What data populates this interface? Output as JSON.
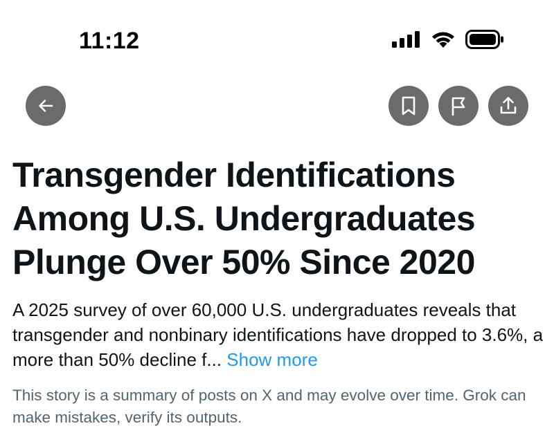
{
  "status_bar": {
    "time": "11:12",
    "icons": [
      "cellular-signal-icon",
      "wifi-icon",
      "battery-icon"
    ]
  },
  "header": {
    "buttons": [
      {
        "name": "back-button",
        "icon": "arrow-left-icon"
      },
      {
        "name": "bookmark-button",
        "icon": "bookmark-icon"
      },
      {
        "name": "report-button",
        "icon": "flag-icon"
      },
      {
        "name": "share-button",
        "icon": "share-upload-icon"
      }
    ],
    "button_color": "#6b6b6b"
  },
  "story": {
    "title": "Transgender Identifications Among U.S. Undergraduates Plunge Over 50% Since 2020",
    "summary": "A 2025 survey of over 60,000 U.S. undergraduates reveals that transgender and nonbinary identifications have dropped to 3.6%, a more than 50% decline f...",
    "show_more_label": "Show more",
    "disclaimer": "This story is a summary of posts on X and may evolve over time. Grok can make mistakes, verify its outputs."
  },
  "colors": {
    "text": "#0f1419",
    "link": "#1d9bf0",
    "muted": "#536471"
  }
}
